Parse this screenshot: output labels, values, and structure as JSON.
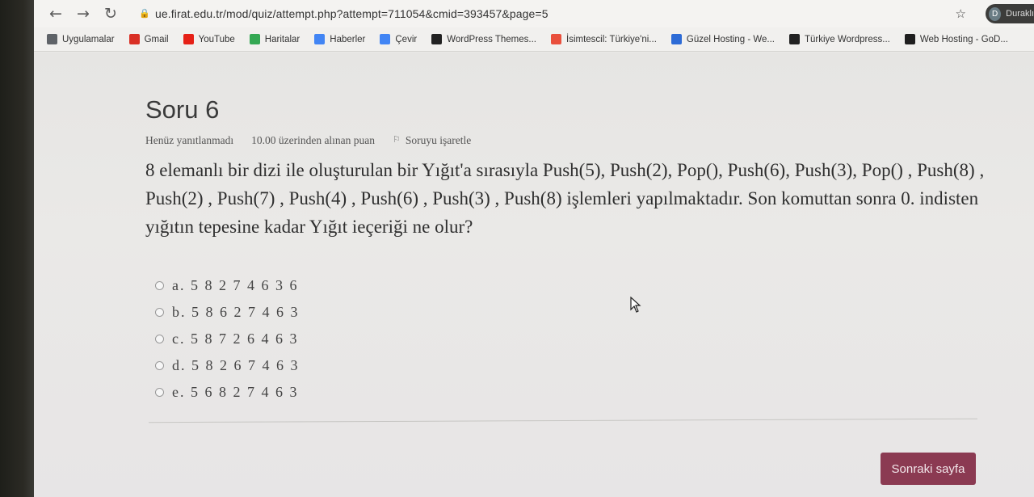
{
  "browser": {
    "url": "ue.firat.edu.tr/mod/quiz/attempt.php?attempt=711054&cmid=393457&page=5",
    "profile_name": "Duraklı",
    "profile_initial": "D",
    "bookmarks": [
      {
        "label": "Uygulamalar",
        "icon": "apps-grid-icon",
        "color": "#5f6368"
      },
      {
        "label": "Gmail",
        "icon": "gmail-icon",
        "color": "#d93025"
      },
      {
        "label": "YouTube",
        "icon": "youtube-icon",
        "color": "#e62117"
      },
      {
        "label": "Haritalar",
        "icon": "maps-icon",
        "color": "#34a853"
      },
      {
        "label": "Haberler",
        "icon": "news-icon",
        "color": "#4285f4"
      },
      {
        "label": "Çevir",
        "icon": "translate-icon",
        "color": "#4285f4"
      },
      {
        "label": "WordPress Themes...",
        "icon": "wordpress-themes-icon",
        "color": "#222222"
      },
      {
        "label": "İsimtescil: Türkiye'ni...",
        "icon": "isimtescil-icon",
        "color": "#e94f3c"
      },
      {
        "label": "Güzel Hosting - We...",
        "icon": "guzel-hosting-icon",
        "color": "#2d6bd6"
      },
      {
        "label": "Türkiye Wordpress...",
        "icon": "turkiye-wordpress-icon",
        "color": "#222222"
      },
      {
        "label": "Web Hosting - GoD...",
        "icon": "godaddy-icon",
        "color": "#1f1f1f"
      }
    ]
  },
  "question": {
    "title": "Soru 6",
    "status": "Henüz yanıtlanmadı",
    "points": "10.00 üzerinden alınan puan",
    "flag_label": "Soruyu işaretle",
    "text": "8 elemanlı bir dizi ile oluşturulan bir Yığıt'a sırasıyla Push(5), Push(2), Pop(), Push(6), Push(3), Pop() , Push(8) , Push(2) , Push(7) , Push(4) , Push(6) , Push(3) , Push(8) işlemleri yapılmaktadır. Son komuttan sonra 0. indisten yığıtın tepesine kadar Yığıt ieçeriği ne olur?",
    "answers": [
      {
        "label": "a. 5 8 2 7 4 6 3 6"
      },
      {
        "label": "b. 5 8 6 2 7 4 6 3"
      },
      {
        "label": "c. 5 8 7 2 6 4 6 3"
      },
      {
        "label": "d. 5 8 2 6 7 4 6 3"
      },
      {
        "label": "e. 5 6 8 2 7 4 6 3"
      }
    ]
  },
  "navigation": {
    "next_label": "Sonraki sayfa",
    "accent_color": "#8b3a52"
  }
}
